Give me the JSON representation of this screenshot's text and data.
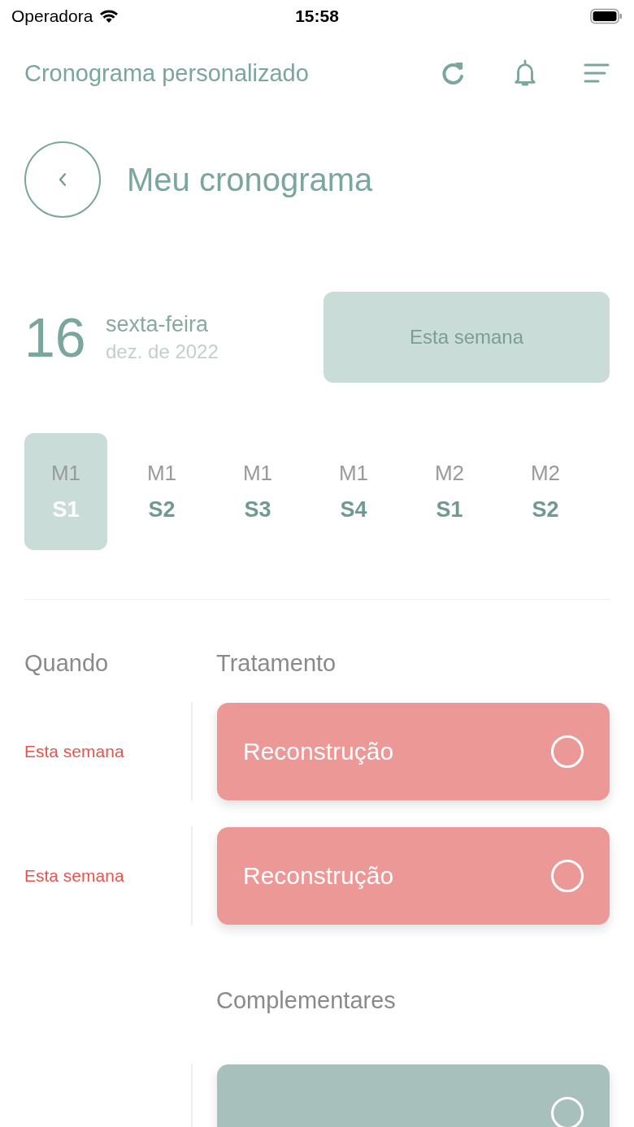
{
  "status_bar": {
    "carrier": "Operadora",
    "time": "15:58"
  },
  "header": {
    "title": "Cronograma personalizado"
  },
  "page": {
    "title": "Meu cronograma"
  },
  "date": {
    "day": "16",
    "weekday": "sexta-feira",
    "month": "dez. de 2022",
    "button": "Esta semana"
  },
  "weeks": [
    {
      "month": "M1",
      "week": "S1",
      "selected": true
    },
    {
      "month": "M1",
      "week": "S2",
      "selected": false
    },
    {
      "month": "M1",
      "week": "S3",
      "selected": false
    },
    {
      "month": "M1",
      "week": "S4",
      "selected": false
    },
    {
      "month": "M2",
      "week": "S1",
      "selected": false
    },
    {
      "month": "M2",
      "week": "S2",
      "selected": false
    }
  ],
  "columns": {
    "when": "Quando",
    "treatment": "Tratamento"
  },
  "sections": [
    {
      "items": [
        {
          "when": "Esta semana",
          "name": "Reconstrução",
          "done": false,
          "color": "#ec9896"
        },
        {
          "when": "Esta semana",
          "name": "Reconstrução",
          "done": false,
          "color": "#ec9896"
        }
      ]
    },
    {
      "title": "Complementares",
      "items": [
        {
          "done": false,
          "color": "#a8c0bb"
        }
      ]
    }
  ]
}
